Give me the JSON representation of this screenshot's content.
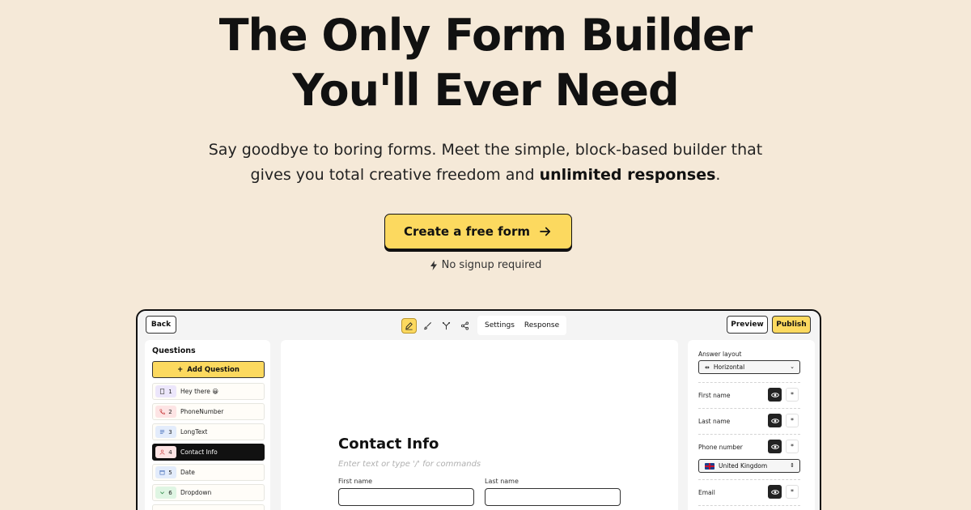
{
  "hero": {
    "title_line1": "The Only Form Builder",
    "title_line2": "You'll Ever Need",
    "subtitle_line1": "Say goodbye to boring forms. Meet the simple, block-based builder that",
    "subtitle_line2_start": "gives you total creative freedom and ",
    "subtitle_line2_bold": "unlimited responses",
    "subtitle_line2_end": ".",
    "cta_label": "Create a free form",
    "note": "No signup required"
  },
  "builder": {
    "back_label": "Back",
    "preview_label": "Preview",
    "publish_label": "Publish",
    "tabs": [
      "Settings",
      "Response"
    ],
    "tools": [
      "pencil-icon",
      "brush-icon",
      "branch-icon",
      "share-icon"
    ],
    "questions_title": "Questions",
    "add_question_label": "Add Question",
    "questions": [
      {
        "num": "1",
        "label": "Hey there 😀",
        "icon": "document-icon",
        "color": "#ece6fb"
      },
      {
        "num": "2",
        "label": "PhoneNumber",
        "icon": "phone-icon",
        "color": "#fde4e4"
      },
      {
        "num": "3",
        "label": "LongText",
        "icon": "lines-icon",
        "color": "#e3ecfb"
      },
      {
        "num": "4",
        "label": "Contact Info",
        "icon": "person-icon",
        "color": "#fde4e4"
      },
      {
        "num": "5",
        "label": "Date",
        "icon": "calendar-icon",
        "color": "#e3ecfb"
      },
      {
        "num": "6",
        "label": "Dropdown",
        "icon": "chevron-icon",
        "color": "#dff5e3"
      }
    ],
    "form": {
      "title": "Contact Info",
      "placeholder": "Enter text or type '/' for commands",
      "first_name_label": "First name",
      "last_name_label": "Last name"
    },
    "settings": {
      "answer_layout_label": "Answer layout",
      "answer_layout_value": "Horizontal",
      "fields": [
        "First name",
        "Last name",
        "Phone number",
        "Email"
      ],
      "country_value": "United Kingdom",
      "required_symbol": "*"
    }
  },
  "colors": {
    "background": "#f5e9d8",
    "accent": "#fcd95f"
  }
}
